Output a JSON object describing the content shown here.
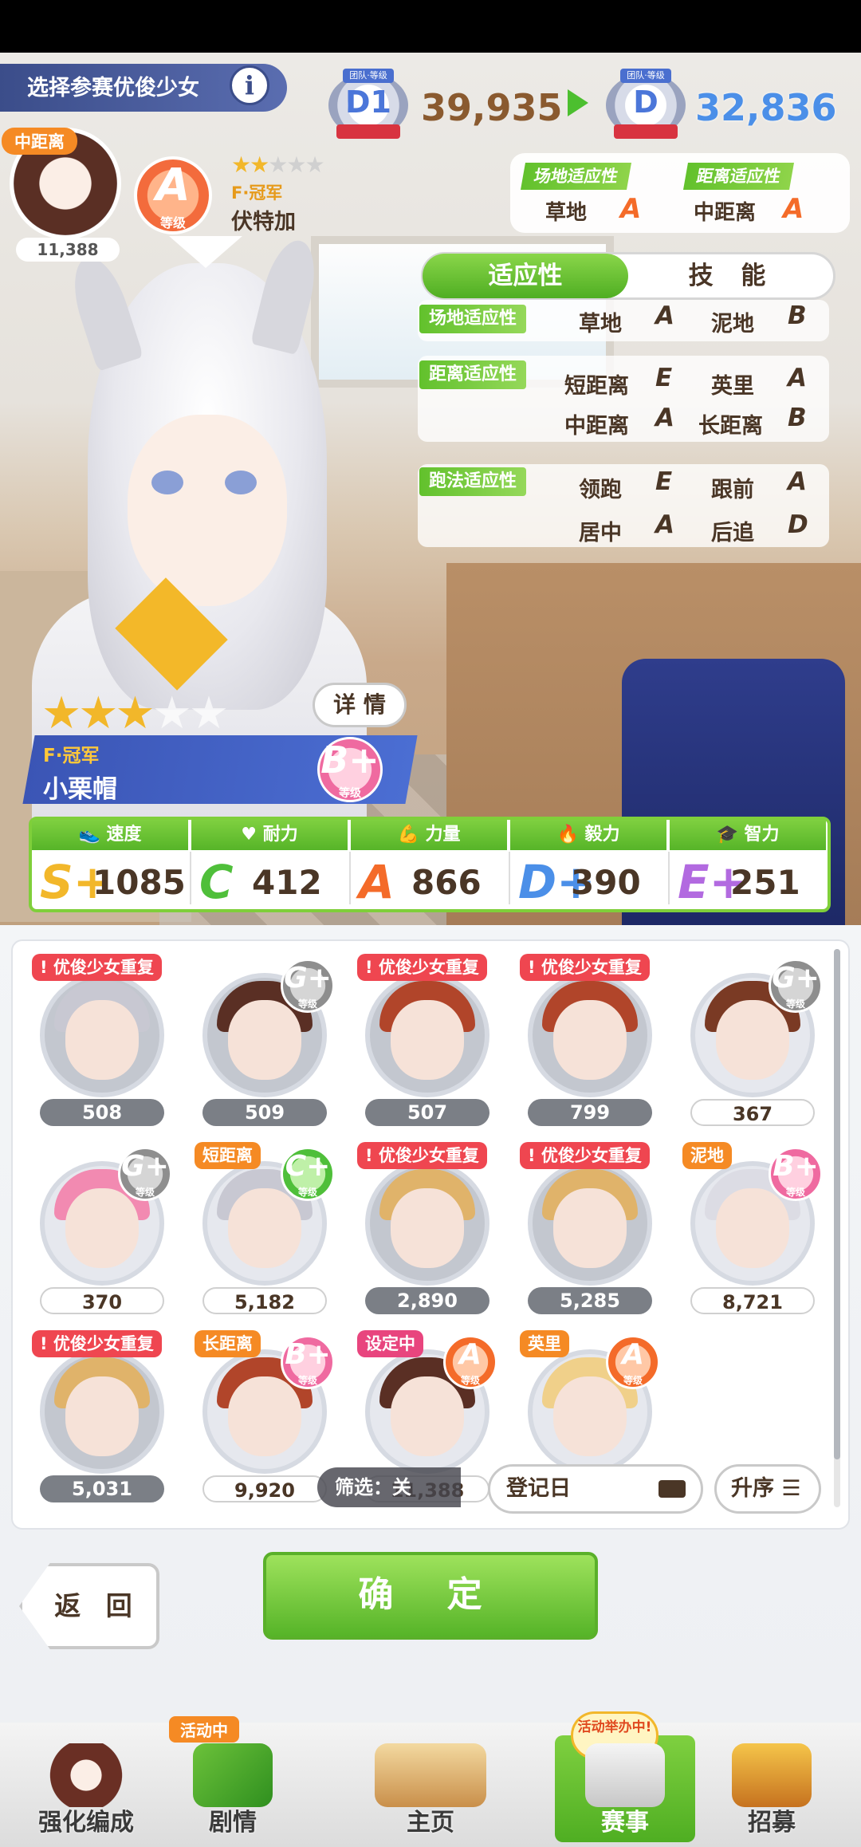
{
  "header": {
    "title": "选择参赛优俊少女",
    "info_icon": "info-icon",
    "rank_caption": "团队·等级",
    "rank_current": "D1",
    "fans_current": "39,935",
    "rank_next": "D",
    "fans_next": "32,836"
  },
  "current_horse": {
    "distance_tag": "中距离",
    "fans": "11,388",
    "grade": "A",
    "grade_caption": "等级",
    "stars": 2,
    "epithet": "F·冠军",
    "name": "伏特加",
    "track_label": "场地适应性",
    "track_value": "草地",
    "track_grade": "A",
    "distance_label": "距离适应性",
    "distance_value": "中距离",
    "distance_grade": "A"
  },
  "tabs": {
    "aptitude": "适应性",
    "skills": "技 能"
  },
  "aptitude": {
    "track": {
      "label": "场地适应性",
      "items": [
        {
          "name": "草地",
          "grade": "A"
        },
        {
          "name": "泥地",
          "grade": "B"
        }
      ]
    },
    "distance": {
      "label": "距离适应性",
      "items": [
        {
          "name": "短距离",
          "grade": "E"
        },
        {
          "name": "英里",
          "grade": "A"
        },
        {
          "name": "中距离",
          "grade": "A"
        },
        {
          "name": "长距离",
          "grade": "B"
        }
      ]
    },
    "style": {
      "label": "跑法适应性",
      "items": [
        {
          "name": "领跑",
          "grade": "E"
        },
        {
          "name": "跟前",
          "grade": "A"
        },
        {
          "name": "居中",
          "grade": "A"
        },
        {
          "name": "后追",
          "grade": "D"
        }
      ]
    }
  },
  "selected": {
    "stars": 3,
    "detail_button": "详 情",
    "epithet": "F·冠军",
    "name": "小栗帽",
    "grade": "B+",
    "grade_caption": "等级"
  },
  "stats": [
    {
      "label": "速度",
      "icon": "shoe-icon",
      "grade": "S+",
      "value": "1085",
      "color": "#f2b72a"
    },
    {
      "label": "耐力",
      "icon": "heart-icon",
      "grade": "C",
      "value": "412",
      "color": "#4fbf3a"
    },
    {
      "label": "力量",
      "icon": "muscle-icon",
      "grade": "A",
      "value": "866",
      "color": "#f46b29"
    },
    {
      "label": "毅力",
      "icon": "flame-icon",
      "grade": "D+",
      "value": "390",
      "color": "#4b8fe8"
    },
    {
      "label": "智力",
      "icon": "graduation-cap-icon",
      "grade": "E+",
      "value": "251",
      "color": "#b26ae0"
    }
  ],
  "roster": [
    {
      "tag": "优俊少女重复",
      "tag_type": "warn",
      "grade": "",
      "fans": "508",
      "hair": "#c8c8d2",
      "dim": true
    },
    {
      "tag": "",
      "tag_type": "",
      "grade": "G+",
      "grade_type": "grey",
      "fans": "509",
      "hair": "#5a2f24",
      "dim": true
    },
    {
      "tag": "优俊少女重复",
      "tag_type": "warn",
      "grade": "",
      "fans": "507",
      "hair": "#b1452a",
      "dim": true
    },
    {
      "tag": "优俊少女重复",
      "tag_type": "warn",
      "grade": "",
      "fans": "799",
      "hair": "#b1452a",
      "dim": true
    },
    {
      "tag": "",
      "tag_type": "",
      "grade": "G+",
      "grade_type": "grey",
      "fans": "367",
      "hair": "#7a3a24",
      "dim": false
    },
    {
      "tag": "",
      "tag_type": "",
      "grade": "G+",
      "grade_type": "grey",
      "fans": "370",
      "hair": "#f28ab1",
      "dim": false
    },
    {
      "tag": "短距离",
      "tag_type": "orange",
      "grade": "C+",
      "grade_type": "green",
      "fans": "5,182",
      "hair": "#c8c8d2",
      "dim": false
    },
    {
      "tag": "优俊少女重复",
      "tag_type": "warn",
      "grade": "",
      "fans": "2,890",
      "hair": "#e0b36a",
      "dim": true
    },
    {
      "tag": "优俊少女重复",
      "tag_type": "warn",
      "grade": "",
      "fans": "5,285",
      "hair": "#e0b36a",
      "dim": true
    },
    {
      "tag": "泥地",
      "tag_type": "orange",
      "grade": "B+",
      "grade_type": "pink",
      "fans": "8,721",
      "hair": "#dcdce4",
      "dim": false
    },
    {
      "tag": "优俊少女重复",
      "tag_type": "warn",
      "grade": "",
      "fans": "5,031",
      "hair": "#e0b36a",
      "dim": true
    },
    {
      "tag": "长距离",
      "tag_type": "orange",
      "grade": "B+",
      "grade_type": "pink",
      "fans": "9,920",
      "hair": "#b1452a",
      "dim": false
    },
    {
      "tag": "设定中",
      "tag_type": "pink",
      "grade": "A",
      "grade_type": "orange",
      "fans": "11,388",
      "hair": "#5a2f24",
      "dim": false
    },
    {
      "tag": "英里",
      "tag_type": "orange",
      "grade": "A",
      "grade_type": "orange",
      "fans": "",
      "hair": "#f0d08a",
      "dim": false
    }
  ],
  "roster_grade_caption": "等级",
  "filter": {
    "label": "筛选：关",
    "sort_key": "登记日",
    "sort_order": "升序"
  },
  "buttons": {
    "back": "返 回",
    "confirm": "确 定"
  },
  "nav": [
    {
      "label": "强化编成",
      "icon": "team-icon",
      "badge": ""
    },
    {
      "label": "剧情",
      "icon": "story-book-icon",
      "badge": "活动中"
    },
    {
      "label": "主页",
      "icon": "home-building-icon",
      "badge": ""
    },
    {
      "label": "赛事",
      "icon": "race-icon",
      "badge": "活动举办中!",
      "active": true
    },
    {
      "label": "招募",
      "icon": "gacha-icon",
      "badge": ""
    }
  ]
}
